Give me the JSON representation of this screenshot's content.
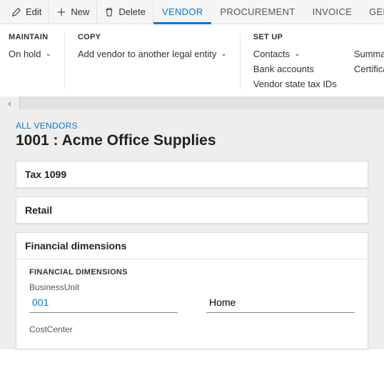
{
  "toolbar": {
    "edit": "Edit",
    "new": "New",
    "delete": "Delete"
  },
  "tabs": {
    "vendor": "VENDOR",
    "procurement": "PROCUREMENT",
    "invoice": "INVOICE",
    "general": "GENER"
  },
  "ribbon": {
    "maintain": {
      "title": "MAINTAIN",
      "on_hold": "On hold"
    },
    "copy": {
      "title": "COPY",
      "add_to_entity": "Add vendor to another legal entity"
    },
    "setup": {
      "title": "SET UP",
      "contacts": "Contacts",
      "bank_accounts": "Bank accounts",
      "vendor_tax_ids": "Vendor state tax IDs",
      "summary_update": "Summary upd",
      "certifications": "Certifications"
    }
  },
  "breadcrumb": "ALL VENDORS",
  "record_title": "1001 : Acme Office Supplies",
  "sections": {
    "tax1099": "Tax 1099",
    "retail": "Retail",
    "fin_dim": "Financial dimensions"
  },
  "fin_dim": {
    "subhead": "FINANCIAL DIMENSIONS",
    "business_unit_label": "BusinessUnit",
    "business_unit_value": "001",
    "business_unit_desc": "Home",
    "cost_center_label": "CostCenter"
  }
}
